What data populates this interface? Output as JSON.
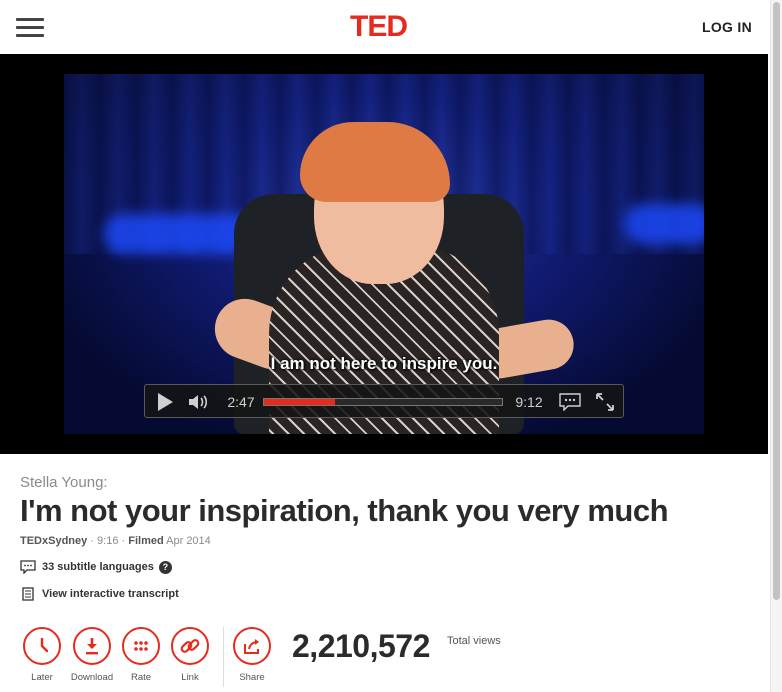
{
  "header": {
    "logo": "TED",
    "login_label": "LOG IN"
  },
  "video": {
    "subtitle_text": "I am not here to inspire you.",
    "current_time": "2:47",
    "duration": "9:12",
    "progress_fraction": 0.3,
    "accent_color": "#e62b1e"
  },
  "talk": {
    "speaker": "Stella Young:",
    "title": "I'm not your inspiration, thank you very much",
    "event": "TEDxSydney",
    "length": "9:16",
    "filmed_label": "Filmed",
    "filmed_date": "Apr 2014"
  },
  "info": {
    "subtitle_languages": "33 subtitle languages",
    "help_symbol": "?",
    "transcript_label": "View interactive transcript"
  },
  "actions": {
    "later": "Later",
    "download": "Download",
    "rate": "Rate",
    "link": "Link",
    "share": "Share"
  },
  "views": {
    "count": "2,210,572",
    "label": "Total views"
  },
  "icons": [
    "hamburger-icon",
    "play-icon",
    "volume-icon",
    "captions-icon",
    "fullscreen-icon",
    "subtitles-icon",
    "help-icon",
    "transcript-icon",
    "clock-icon",
    "download-icon",
    "rate-icon",
    "link-icon",
    "share-icon"
  ]
}
